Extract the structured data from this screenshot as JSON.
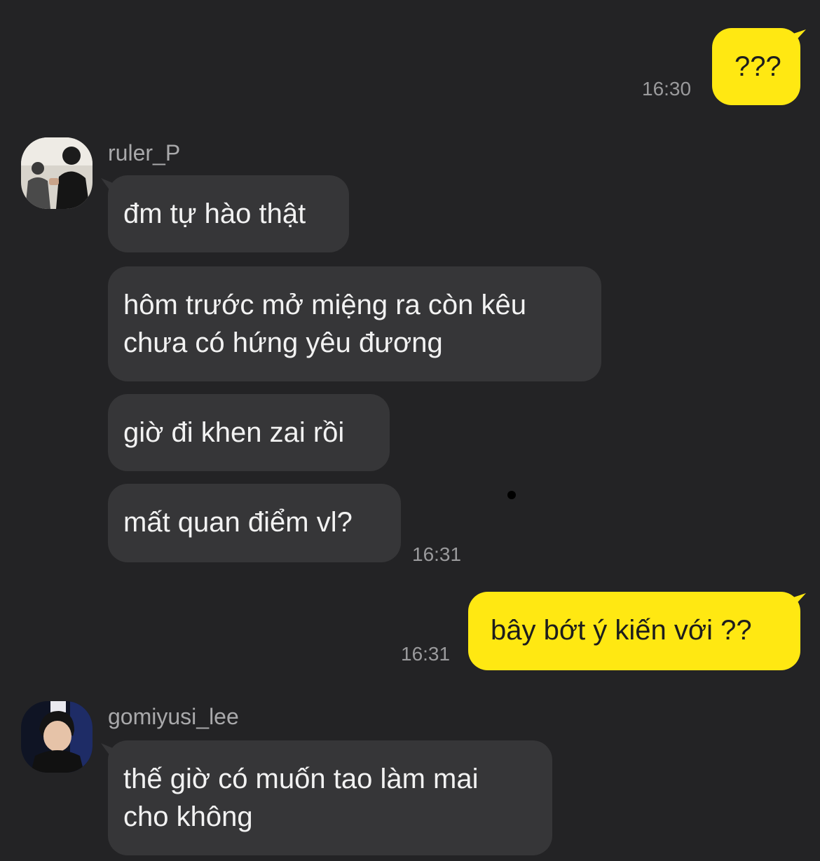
{
  "colors": {
    "background": "#232325",
    "incoming_bubble": "#363638",
    "outgoing_bubble": "#ffe812",
    "timestamp": "#9a9a9c"
  },
  "messages": [
    {
      "direction": "out",
      "text": "???",
      "time": "16:30"
    },
    {
      "direction": "in",
      "sender": "ruler_P",
      "avatar": "avatar-ruler_P",
      "texts": [
        "đm tự hào thật",
        "hôm trước mở miệng ra còn kêu\nchưa có hứng yêu đương",
        "giờ đi khen zai rồi",
        "mất quan điểm vl?"
      ],
      "time": "16:31"
    },
    {
      "direction": "out",
      "text": "bây bớt ý kiến với ??",
      "time": "16:31"
    },
    {
      "direction": "in",
      "sender": "gomiyusi_lee",
      "avatar": "avatar-gomiyusi_lee",
      "texts": [
        "thế giờ có muốn tao làm mai\ncho không"
      ]
    }
  ]
}
